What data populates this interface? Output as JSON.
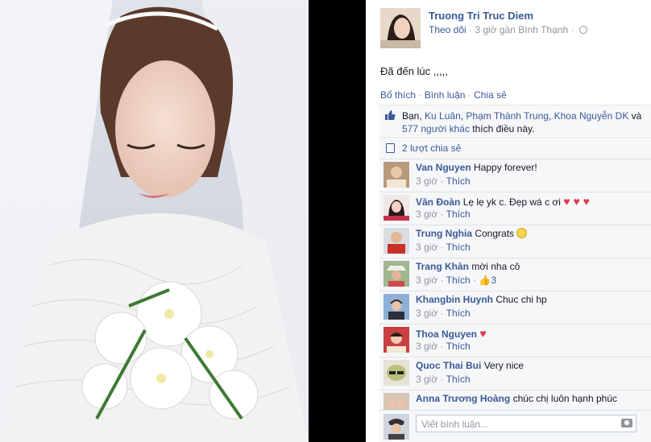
{
  "post": {
    "author": "Truong Tri Truc Diem",
    "follow_label": "Theo dõi",
    "time_location": "· 3 giờ gần Bình Thạnh ·",
    "text": "Đã đến lúc ,,,,,",
    "actions": {
      "like": "Bổ thích",
      "comment": "Bình luận",
      "share": "Chia sẻ",
      "sep": " · "
    }
  },
  "likes": {
    "prefix": "Bạn, ",
    "names": [
      "Ku Luân",
      "Phạm Thành Trung",
      "Khoa Nguyễn DK"
    ],
    "and": " và ",
    "others": "577 người khác",
    "suffix": " thích điều này."
  },
  "shares": {
    "label": "2 lượt chia sẻ"
  },
  "comments": [
    {
      "name": "Van Nguyen",
      "text": "Happy forever!",
      "time": "3 giờ",
      "like": "Thích"
    },
    {
      "name": "Văn Đoàn",
      "text": "Lẹ lẹ yk c. Đẹp wá c ơi",
      "hearts": "♥ ♥ ♥",
      "time": "3 giờ",
      "like": "Thích"
    },
    {
      "name": "Trung Nghia",
      "text": "Congrats",
      "time": "3 giờ",
      "like": "Thích"
    },
    {
      "name": "Trang Khàn",
      "text": "mời nha cô",
      "time": "3 giờ",
      "like": "Thích",
      "like_count": "3"
    },
    {
      "name": "Khangbin Huynh",
      "text": "Chuc chi hp",
      "time": "3 giờ",
      "like": "Thích"
    },
    {
      "name": "Thoa Nguyen",
      "hearts": "♥",
      "time": "3 giờ",
      "like": "Thích"
    },
    {
      "name": "Quoc Thai Bui",
      "text": "Very nice",
      "time": "3 giờ",
      "like": "Thích"
    },
    {
      "name": "Anna Trương Hoàng",
      "text": "chúc chị luôn hạnh phúc",
      "hearts": "♥"
    }
  ],
  "composer": {
    "placeholder": "Viết bình luận..."
  },
  "colors": {
    "link": "#3b5998",
    "meta": "#90949c",
    "heart": "#e0394d",
    "panel_bg": "#f6f7f9"
  },
  "icons": [
    "globe-icon",
    "thumbs-up-icon",
    "share-icon",
    "smile-emoticon-icon",
    "heart-icon",
    "camera-icon"
  ]
}
